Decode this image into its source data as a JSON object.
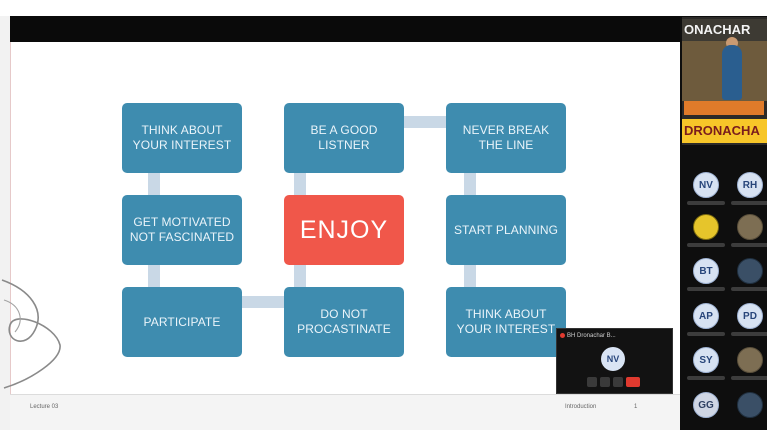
{
  "slide": {
    "tiles": [
      "THINK ABOUT YOUR INTEREST",
      "BE A GOOD LISTNER",
      "NEVER BREAK THE LINE",
      "GET MOTIVATED NOT FASCINATED",
      "ENJOY",
      "START PLANNING",
      "PARTICIPATE",
      "DO NOT PROCASTINATE",
      "THINK ABOUT YOUR INTEREST"
    ],
    "footer_left": "Lecture 03",
    "footer_right": "Introduction",
    "footer_page": "1"
  },
  "video": {
    "banner_top": "ONACHAR",
    "banner_bottom": "DRONACHA"
  },
  "participants": [
    {
      "initials": "NV"
    },
    {
      "initials": "RH"
    },
    {
      "initials": ""
    },
    {
      "initials": ""
    },
    {
      "initials": "BT"
    },
    {
      "initials": ""
    },
    {
      "initials": "AP"
    },
    {
      "initials": "PD"
    },
    {
      "initials": "SY"
    },
    {
      "initials": ""
    },
    {
      "initials": "GG"
    },
    {
      "initials": ""
    }
  ],
  "mini_window": {
    "title": "BH Dronachar B...",
    "avatar": "NV"
  },
  "colors": {
    "tile": "#3e8caf",
    "center_tile": "#f0574a",
    "connector": "#c9d8e6"
  }
}
